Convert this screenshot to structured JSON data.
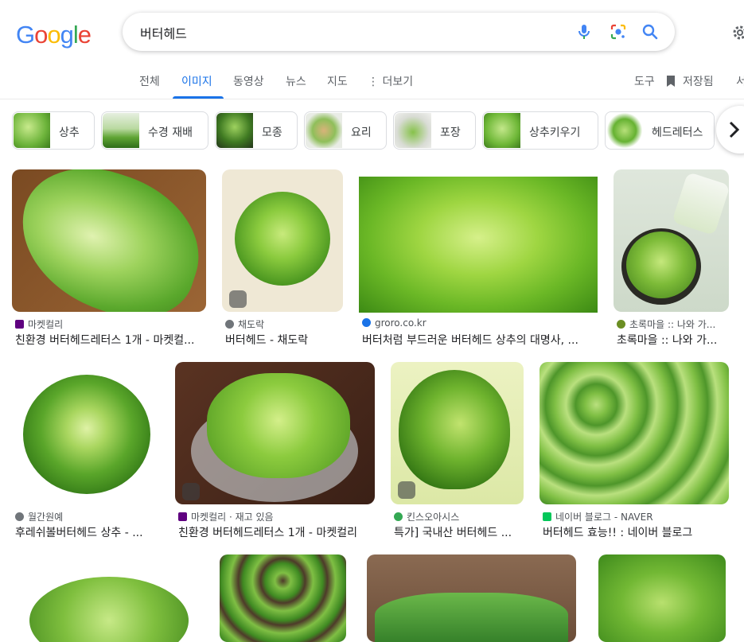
{
  "logo": {
    "letters": [
      "G",
      "o",
      "o",
      "g",
      "l",
      "e"
    ],
    "colors": [
      "#4285f4",
      "#ea4335",
      "#fbbc05",
      "#4285f4",
      "#34a853",
      "#ea4335"
    ]
  },
  "search": {
    "query": "버터헤드"
  },
  "icons": {
    "mic": "mic-icon",
    "lens": "lens-icon",
    "search": "search-icon",
    "settings": "gear-icon"
  },
  "tabs": [
    {
      "label": "전체"
    },
    {
      "label": "이미지"
    },
    {
      "label": "동영상"
    },
    {
      "label": "뉴스"
    },
    {
      "label": "지도"
    },
    {
      "label": "⋮ 더보기"
    },
    {
      "label": "도구"
    },
    {
      "label": "저장됨"
    },
    {
      "label": "서"
    }
  ],
  "chips": [
    {
      "label": "상추"
    },
    {
      "label": "수경 재배"
    },
    {
      "label": "모종"
    },
    {
      "label": "요리"
    },
    {
      "label": "포장"
    },
    {
      "label": "상추키우기"
    },
    {
      "label": "헤드레터스"
    }
  ],
  "results": [
    {
      "source": "마켓컬리",
      "title": "친환경 버터헤드레터스 1개 - 마켓컬..."
    },
    {
      "source": "채도락",
      "title": "버터헤드 - 채도락"
    },
    {
      "source": "groro.co.kr",
      "title": "버터처럼 부드러운 버터헤드 상추의 대명사, ..."
    },
    {
      "source": "초록마을 :: 나와 가...",
      "title": "초록마을 :: 나와 가..."
    },
    {
      "source": "월간원예",
      "title": "후레쉬볼버터헤드 상추 - ..."
    },
    {
      "source": "마켓컬리 · 재고 있음",
      "title": "친환경 버터헤드레터스 1개 - 마켓컬리"
    },
    {
      "source": "킨스오아시스",
      "title": "특가] 국내산 버터헤드 ..."
    },
    {
      "source": "네이버 블로그 - NAVER",
      "title": "버터헤드 효능!! : 네이버 블로그"
    }
  ],
  "colors": {
    "accent": "#1a73e8",
    "lettuce_light": "#b7e07a",
    "lettuce_mid": "#7cc242",
    "lettuce_dark": "#3f8a1f"
  }
}
